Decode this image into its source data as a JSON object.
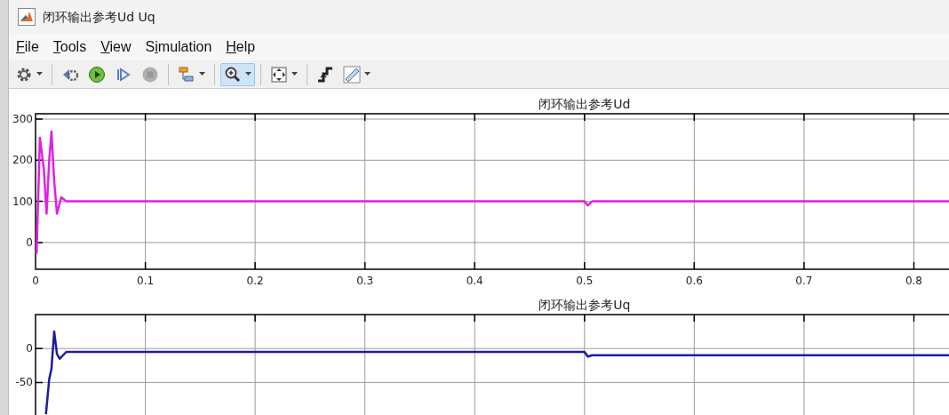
{
  "window": {
    "title": "闭环输出参考Ud Uq"
  },
  "menu": [
    {
      "key": "F",
      "after": "ile"
    },
    {
      "key": "T",
      "after": "ools"
    },
    {
      "key": "V",
      "after": "iew"
    },
    {
      "before": "S",
      "key": "i",
      "after": "mulation"
    },
    {
      "key": "H",
      "after": "elp"
    }
  ],
  "toolbar": [
    {
      "kind": "settings",
      "dropdown": true,
      "selected": false,
      "disabled": false
    },
    {
      "kind": "separator"
    },
    {
      "kind": "step-back",
      "dropdown": false,
      "selected": false,
      "disabled": false
    },
    {
      "kind": "run",
      "dropdown": false,
      "selected": false,
      "disabled": false
    },
    {
      "kind": "step-forward",
      "dropdown": false,
      "selected": false,
      "disabled": false
    },
    {
      "kind": "stop",
      "dropdown": false,
      "selected": false,
      "disabled": true
    },
    {
      "kind": "separator"
    },
    {
      "kind": "signals",
      "dropdown": true,
      "selected": false,
      "disabled": false
    },
    {
      "kind": "separator"
    },
    {
      "kind": "zoom",
      "dropdown": true,
      "selected": true,
      "disabled": false
    },
    {
      "kind": "separator"
    },
    {
      "kind": "autoscale",
      "dropdown": true,
      "selected": false,
      "disabled": false
    },
    {
      "kind": "separator"
    },
    {
      "kind": "triggers",
      "dropdown": false,
      "selected": false,
      "disabled": false
    },
    {
      "kind": "measure",
      "dropdown": true,
      "selected": false,
      "disabled": false
    }
  ],
  "plots": [
    {
      "chart_data": {
        "type": "line",
        "title": "闭环输出参考Ud",
        "grid": true,
        "xlim": [
          0,
          0.832
        ],
        "ylim": [
          -65,
          313
        ],
        "xticks": [
          {
            "value": 0,
            "label": "0"
          },
          {
            "value": 0.1,
            "label": "0.1"
          },
          {
            "value": 0.2,
            "label": "0.2"
          },
          {
            "value": 0.3,
            "label": "0.3"
          },
          {
            "value": 0.4,
            "label": "0.4"
          },
          {
            "value": 0.5,
            "label": "0.5"
          },
          {
            "value": 0.6,
            "label": "0.6"
          },
          {
            "value": 0.7,
            "label": "0.7"
          },
          {
            "value": 0.8,
            "label": "0.8"
          }
        ],
        "yticks": [
          {
            "value": 0,
            "label": "0"
          },
          {
            "value": 100,
            "label": "100"
          },
          {
            "value": 200,
            "label": "200"
          },
          {
            "value": 300,
            "label": "300"
          }
        ],
        "x": [
          0,
          0.001,
          0.004,
          0.0075,
          0.01,
          0.0125,
          0.0145,
          0.017,
          0.0195,
          0.0235,
          0.028,
          0.1,
          0.2,
          0.3,
          0.4,
          0.5,
          0.503,
          0.507,
          0.6,
          0.7,
          0.8,
          0.832
        ],
        "series": [
          {
            "color": "#e020e0",
            "values": [
              0,
              -25,
              255,
              180,
              70,
              200,
              270,
              150,
              70,
              110,
              100,
              100,
              100,
              100,
              100,
              100,
              90,
              100,
              100,
              100,
              100,
              100
            ]
          }
        ]
      }
    },
    {
      "chart_data": {
        "type": "line",
        "title": "闭环输出参考Uq",
        "grid": true,
        "xlim": [
          0,
          0.832
        ],
        "ylim": [
          -98,
          50
        ],
        "yticks": [
          {
            "value": 0,
            "label": "0"
          },
          {
            "value": -50,
            "label": "-50"
          }
        ],
        "x": [
          0.0095,
          0.0125,
          0.0145,
          0.017,
          0.0195,
          0.022,
          0.028,
          0.1,
          0.2,
          0.3,
          0.4,
          0.5,
          0.503,
          0.507,
          0.6,
          0.7,
          0.8,
          0.832
        ],
        "series": [
          {
            "color": "#1c1ca0",
            "values": [
              -97,
              -45,
              -30,
              25,
              -8,
              -15,
              -5,
              -5,
              -5,
              -5,
              -5,
              -5,
              -12,
              -10,
              -10,
              -10,
              -10,
              -10
            ]
          }
        ]
      }
    }
  ]
}
